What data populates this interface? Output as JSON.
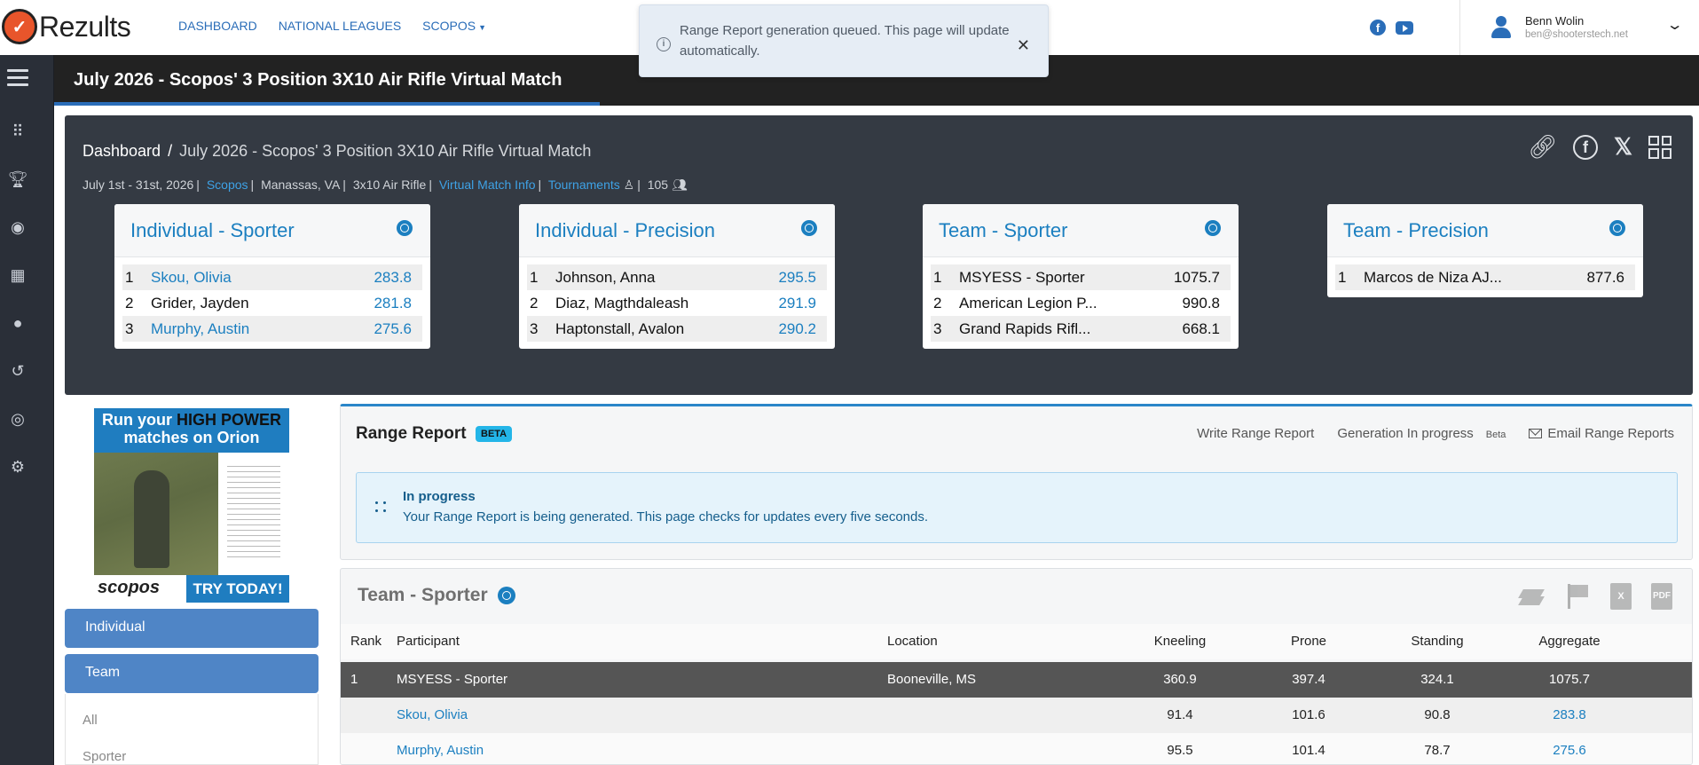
{
  "header": {
    "logo_text": "Rezults",
    "nav": [
      "DASHBOARD",
      "NATIONAL LEAGUES",
      "SCOPOS"
    ],
    "toast": "Range Report generation queued. This page will update automatically.",
    "user_name": "Benn Wolin",
    "user_email": "ben@shooterstech.net"
  },
  "title_bar": "July 2026 - Scopos' 3 Position 3X10 Air Rifle Virtual Match",
  "summary": {
    "breadcrumb_root": "Dashboard",
    "breadcrumb_current": "July 2026 - Scopos' 3 Position 3X10 Air Rifle Virtual Match",
    "meta_dates": "July 1st - 31st, 2026",
    "meta_org": "Scopos",
    "meta_location": "Manassas, VA",
    "meta_event": "3x10 Air Rifle",
    "meta_info_link": "Virtual Match Info",
    "meta_tournaments": "Tournaments",
    "meta_count": "105",
    "cards": [
      {
        "title": "Individual - Sporter",
        "rows": [
          {
            "rank": "1",
            "name": "Skou, Olivia",
            "score": "283.8"
          },
          {
            "rank": "2",
            "name": "Grider, Jayden",
            "score": "281.8"
          },
          {
            "rank": "3",
            "name": "Murphy, Austin",
            "score": "275.6"
          }
        ]
      },
      {
        "title": "Individual - Precision",
        "rows": [
          {
            "rank": "1",
            "name": "Johnson, Anna",
            "score": "295.5"
          },
          {
            "rank": "2",
            "name": "Diaz, Magthdaleash",
            "score": "291.9"
          },
          {
            "rank": "3",
            "name": "Haptonstall, Avalon",
            "score": "290.2"
          }
        ]
      },
      {
        "title": "Team - Sporter",
        "rows": [
          {
            "rank": "1",
            "name": "MSYESS - Sporter",
            "score": "1075.7"
          },
          {
            "rank": "2",
            "name": "American Legion P...",
            "score": "990.8"
          },
          {
            "rank": "3",
            "name": "Grand Rapids Rifl...",
            "score": "668.1"
          }
        ]
      },
      {
        "title": "Team - Precision",
        "rows": [
          {
            "rank": "1",
            "name": "Marcos de Niza AJ...",
            "score": "877.6"
          }
        ]
      }
    ]
  },
  "ad": {
    "line1_a": "Run your ",
    "line1_b": "HIGH POWER",
    "line2": "matches on Orion",
    "brand": "scopos",
    "cta": "TRY TODAY!"
  },
  "left_nav": {
    "individual": "Individual",
    "team": "Team",
    "sub_items": [
      "All",
      "Sporter"
    ]
  },
  "range_report": {
    "title": "Range Report",
    "badge": "BETA",
    "write": "Write Range Report",
    "generation": "Generation In progress",
    "generation_badge": "Beta",
    "email": "Email Range Reports",
    "status_title": "In progress",
    "status_text": "Your Range Report is being generated. This page checks for updates every five seconds."
  },
  "team_table": {
    "title": "Team - Sporter",
    "columns": [
      "Rank",
      "Participant",
      "Location",
      "Kneeling",
      "Prone",
      "Standing",
      "Aggregate"
    ],
    "rows": [
      {
        "rank": "1",
        "participant": "MSYESS - Sporter",
        "location": "Booneville, MS",
        "kneeling": "360.9",
        "prone": "397.4",
        "standing": "324.1",
        "aggregate": "1075.7"
      },
      {
        "rank": "",
        "participant": "Skou, Olivia",
        "location": "",
        "kneeling": "91.4",
        "prone": "101.6",
        "standing": "90.8",
        "aggregate": "283.8"
      },
      {
        "rank": "",
        "participant": "Murphy, Austin",
        "location": "",
        "kneeling": "95.5",
        "prone": "101.4",
        "standing": "78.7",
        "aggregate": "275.6"
      }
    ]
  },
  "colors": {
    "accent": "#2a6db8",
    "link": "#1b7fc0",
    "dark_panel": "#343a43",
    "title_bar": "#222222"
  }
}
